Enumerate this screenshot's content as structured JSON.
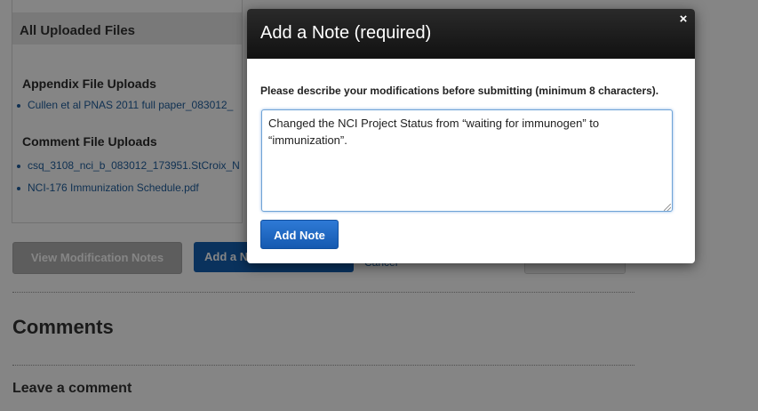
{
  "uploads": {
    "header": "All Uploaded Files",
    "appendix_title": "Appendix File Uploads",
    "appendix_files": [
      "Cullen et al PNAS 2011 full paper_083012_"
    ],
    "comment_title": "Comment File Uploads",
    "comment_files": [
      "csq_3108_nci_b_083012_173951.StCroix_N",
      "NCI-176 Immunization Schedule.pdf"
    ]
  },
  "actions": {
    "view_notes_label": "View Modification Notes",
    "add_label": "Add a N",
    "cancel_label": "Cancel"
  },
  "comments": {
    "title": "Comments",
    "leave_label": "Leave a comment"
  },
  "modal": {
    "title": "Add a Note (required)",
    "close_glyph": "×",
    "instructions": "Please describe your modifications before submitting (minimum 8 characters).",
    "note_value": "Changed the NCI Project Status from “waiting for immunogen” to “immunization”.",
    "add_button_label": "Add Note"
  },
  "colors": {
    "accent": "#1560b3",
    "link": "#1f5e9e",
    "modal_header": "#1a1a1a",
    "overlay": "rgba(0,0,0,0.48)"
  }
}
